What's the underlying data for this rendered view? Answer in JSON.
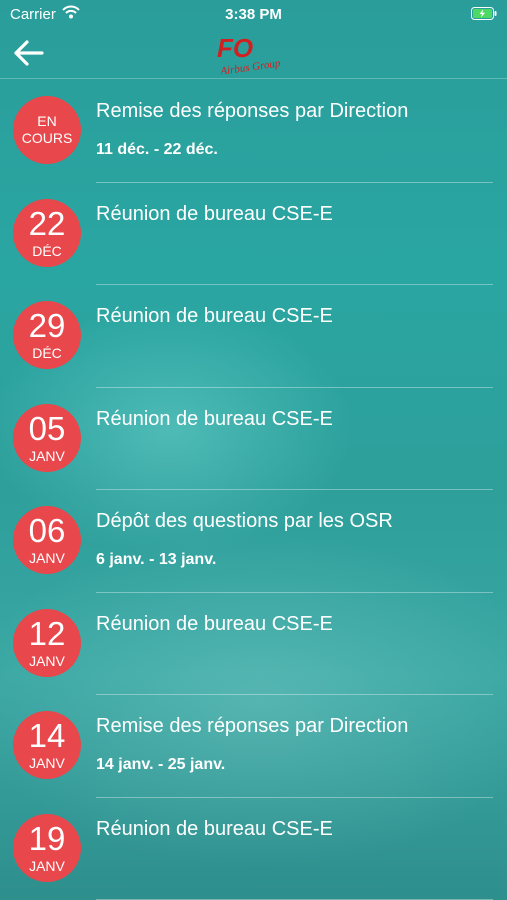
{
  "status_bar": {
    "carrier": "Carrier",
    "time": "3:38 PM"
  },
  "nav": {
    "back_icon": "arrow-left-icon",
    "logo_text": "FO",
    "logo_subtitle": "Airbus Group"
  },
  "colors": {
    "badge": "#e8474b",
    "background": "#2aa6a2"
  },
  "events": [
    {
      "status": "EN\nCOURS",
      "day": null,
      "month": null,
      "title": "Remise des réponses par Direction",
      "dates": "11 déc. - 22 déc."
    },
    {
      "status": null,
      "day": "22",
      "month": "DÉC",
      "title": "Réunion de bureau CSE-E",
      "dates": null
    },
    {
      "status": null,
      "day": "29",
      "month": "DÉC",
      "title": "Réunion de bureau CSE-E",
      "dates": null
    },
    {
      "status": null,
      "day": "05",
      "month": "JANV",
      "title": "Réunion de bureau CSE-E",
      "dates": null
    },
    {
      "status": null,
      "day": "06",
      "month": "JANV",
      "title": "Dépôt des questions par les OSR",
      "dates": "6 janv. - 13 janv."
    },
    {
      "status": null,
      "day": "12",
      "month": "JANV",
      "title": "Réunion de bureau CSE-E",
      "dates": null
    },
    {
      "status": null,
      "day": "14",
      "month": "JANV",
      "title": "Remise des réponses par Direction",
      "dates": "14 janv. - 25 janv."
    },
    {
      "status": null,
      "day": "19",
      "month": "JANV",
      "title": "Réunion de bureau CSE-E",
      "dates": null
    }
  ]
}
